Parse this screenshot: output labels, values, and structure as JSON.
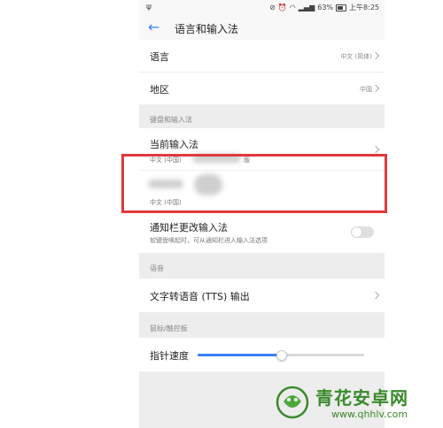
{
  "status": {
    "battery": "63%",
    "time": "上午8:25"
  },
  "header": {
    "title": "语言和输入法"
  },
  "language": {
    "label": "语言",
    "value": "中文 (简体)"
  },
  "region": {
    "label": "地区",
    "value": "中国"
  },
  "sections": {
    "keyboard": "键盘和输入法",
    "voice": "语音",
    "pointer": "鼠标/触控板"
  },
  "current_ime": {
    "label": "当前输入法",
    "sub": "中文 (中国)",
    "sub_tail": "版"
  },
  "ime_item": {
    "sub": "中文 (中国)"
  },
  "notification_switch": {
    "label": "通知栏更改输入法",
    "description": "软键盘唤起时，可从通知栏进入输入法选项",
    "enabled": false
  },
  "tts": {
    "label": "文字转语音 (TTS) 输出"
  },
  "pointer_speed": {
    "label": "指针速度",
    "level": 0.5
  },
  "watermark": {
    "name": "青花安卓网",
    "url": "www.qhhlv.com"
  },
  "colors": {
    "accent": "#3b82f6",
    "highlight_box": "#e0393e",
    "watermark": "#3a8a2a"
  }
}
